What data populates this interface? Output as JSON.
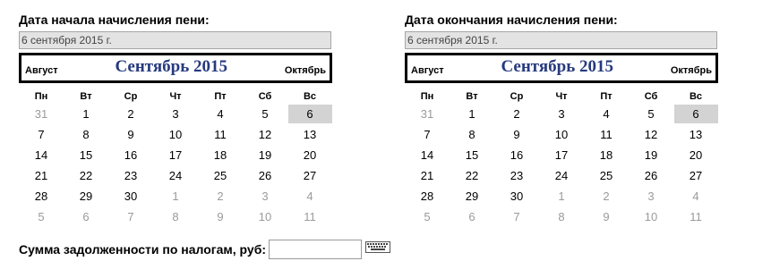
{
  "left": {
    "label": "Дата начала начисления пени:",
    "date_value": "6 сентября 2015 г.",
    "prev_month": "Август",
    "month_title": "Сентябрь 2015",
    "next_month": "Октябрь"
  },
  "right": {
    "label": "Дата окончания начисления пени:",
    "date_value": "6 сентября 2015 г.",
    "prev_month": "Август",
    "month_title": "Сентябрь 2015",
    "next_month": "Октябрь"
  },
  "weekdays": [
    "Пн",
    "Вт",
    "Ср",
    "Чт",
    "Пт",
    "Сб",
    "Вс"
  ],
  "calendar": {
    "weeks": [
      [
        "31",
        "1",
        "2",
        "3",
        "4",
        "5",
        "6"
      ],
      [
        "7",
        "8",
        "9",
        "10",
        "11",
        "12",
        "13"
      ],
      [
        "14",
        "15",
        "16",
        "17",
        "18",
        "19",
        "20"
      ],
      [
        "21",
        "22",
        "23",
        "24",
        "25",
        "26",
        "27"
      ],
      [
        "28",
        "29",
        "30",
        "1",
        "2",
        "3",
        "4"
      ],
      [
        "5",
        "6",
        "7",
        "8",
        "9",
        "10",
        "11"
      ]
    ],
    "other_month": [
      [
        true,
        false,
        false,
        false,
        false,
        false,
        false
      ],
      [
        false,
        false,
        false,
        false,
        false,
        false,
        false
      ],
      [
        false,
        false,
        false,
        false,
        false,
        false,
        false
      ],
      [
        false,
        false,
        false,
        false,
        false,
        false,
        false
      ],
      [
        false,
        false,
        false,
        true,
        true,
        true,
        true
      ],
      [
        true,
        true,
        true,
        true,
        true,
        true,
        true
      ]
    ],
    "selected": "6"
  },
  "debt": {
    "label": "Сумма задолженности по налогам, руб:",
    "value": ""
  },
  "icons": {
    "keyboard": "keyboard-icon"
  }
}
